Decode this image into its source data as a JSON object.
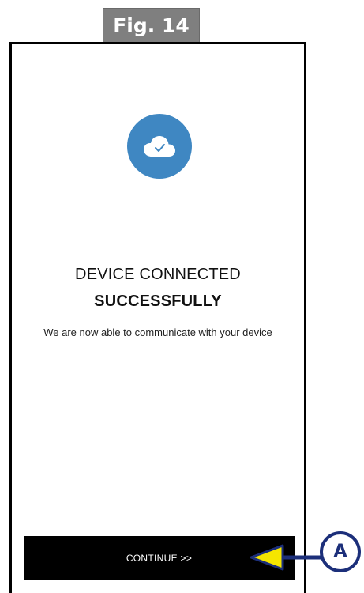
{
  "figure": {
    "label": "Fig. 14"
  },
  "screen": {
    "icon": "cloud-check-icon",
    "title_line1": "DEVICE CONNECTED",
    "title_line2": "SUCCESSFULLY",
    "message": "We are now able to communicate with your device",
    "continue_label": "CONTINUE >>"
  },
  "callout": {
    "letter": "A"
  },
  "colors": {
    "accent": "#3f87c2",
    "button_bg": "#000000",
    "callout_stroke": "#1c2f7a",
    "callout_arrow": "#f5e600",
    "figure_label_bg": "#7f7f7f"
  }
}
